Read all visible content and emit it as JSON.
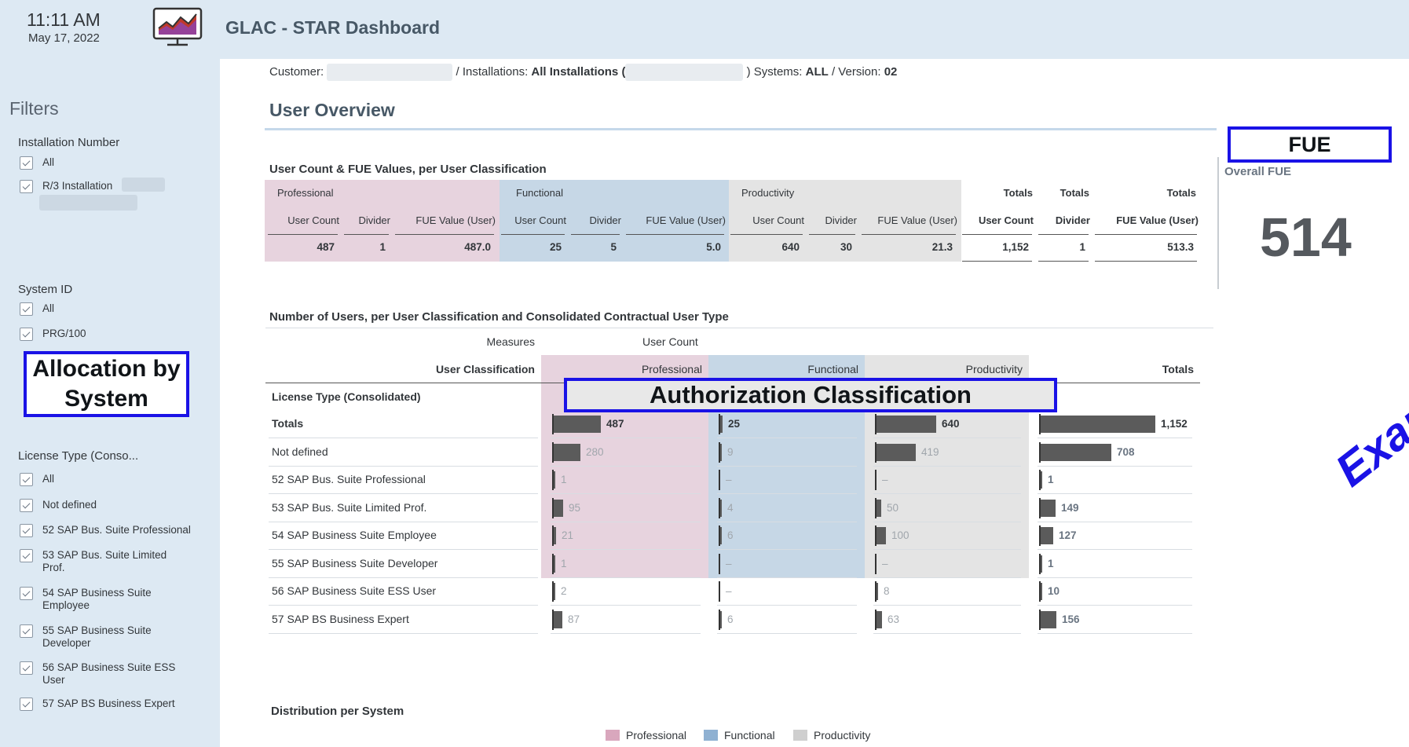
{
  "header": {
    "time": "11:11 AM",
    "date": "May 17, 2022",
    "title": "GLAC - STAR Dashboard",
    "logo_icon": "monitor-chart-icon"
  },
  "sidebar": {
    "title": "Filters",
    "groups": [
      {
        "title": "Installation Number",
        "items": [
          "All",
          "R/3 Installation"
        ]
      },
      {
        "title": "System ID",
        "items": [
          "All",
          "PRG/100"
        ]
      },
      {
        "title": "License Type (Conso...",
        "items": [
          "All",
          "Not defined",
          "52 SAP Bus. Suite Professional",
          "53 SAP Bus. Suite Limited Prof.",
          "54 SAP Business Suite Employee",
          "55 SAP Business Suite Developer",
          "56 SAP Business Suite ESS User",
          "57 SAP BS Business Expert"
        ]
      }
    ]
  },
  "breadcrumb": {
    "customer_label": "Customer:",
    "installations_label": "/ Installations:",
    "installations_value": "All Installations (",
    "systems_label": ") Systems:",
    "systems_value": "ALL",
    "version_label": "/ Version:",
    "version_value": "02"
  },
  "section_title": "User Overview",
  "fue_table": {
    "title": "User Count & FUE Values, per User Classification",
    "groups": [
      "Professional",
      "Functional",
      "Productivity",
      "Totals",
      "Totals",
      "Totals"
    ],
    "columns": [
      "User Count",
      "Divider",
      "FUE Value (User)",
      "User Count",
      "Divider",
      "FUE Value (User)",
      "User Count",
      "Divider",
      "FUE Value (User)",
      "User Count",
      "Divider",
      "FUE Value (User)"
    ],
    "values": [
      "487",
      "1",
      "487.0",
      "25",
      "5",
      "5.0",
      "640",
      "30",
      "21.3",
      "1,152",
      "1",
      "513.3"
    ]
  },
  "overall_fue": {
    "label": "Overall FUE",
    "value": "514"
  },
  "users_table": {
    "title": "Number of Users, per User Classification and Consolidated Contractual User Type",
    "measures_label": "Measures",
    "measures_value": "User Count",
    "classification_label": "User Classification",
    "license_label": "License Type (Consolidated)",
    "columns": [
      "Professional",
      "Functional",
      "Productivity",
      "Totals"
    ],
    "rows": [
      {
        "label": "Totals",
        "values": [
          487,
          25,
          640,
          1152
        ],
        "display": [
          "487",
          "25",
          "640",
          "1,152"
        ]
      },
      {
        "label": "Not defined",
        "values": [
          280,
          9,
          419,
          708
        ],
        "display": [
          "280",
          "9",
          "419",
          "708"
        ]
      },
      {
        "label": "52 SAP Bus. Suite Professional",
        "values": [
          1,
          0,
          0,
          1
        ],
        "display": [
          "1",
          "–",
          "–",
          "1"
        ]
      },
      {
        "label": "53 SAP Bus. Suite Limited Prof.",
        "values": [
          95,
          4,
          50,
          149
        ],
        "display": [
          "95",
          "4",
          "50",
          "149"
        ]
      },
      {
        "label": "54 SAP Business Suite Employee",
        "values": [
          21,
          6,
          100,
          127
        ],
        "display": [
          "21",
          "6",
          "100",
          "127"
        ]
      },
      {
        "label": "55 SAP Business Suite Developer",
        "values": [
          1,
          0,
          0,
          1
        ],
        "display": [
          "1",
          "–",
          "–",
          "1"
        ]
      },
      {
        "label": "56 SAP Business Suite ESS User",
        "values": [
          2,
          0,
          8,
          10
        ],
        "display": [
          "2",
          "–",
          "8",
          "10"
        ]
      },
      {
        "label": "57 SAP BS Business Expert",
        "values": [
          87,
          6,
          63,
          156
        ],
        "display": [
          "87",
          "6",
          "63",
          "156"
        ]
      }
    ]
  },
  "distribution": {
    "title": "Distribution per System",
    "legend": [
      {
        "name": "Professional",
        "color": "#d9a7bd"
      },
      {
        "name": "Functional",
        "color": "#8fb1d2"
      },
      {
        "name": "Productivity",
        "color": "#cfcfcf"
      }
    ]
  },
  "annotations": {
    "allocation": "Allocation by System",
    "authorization": "Authorization Classification",
    "fue": "FUE",
    "exam": "Exam"
  },
  "colors": {
    "professional_bg": "#e7d3de",
    "functional_bg": "#c6d7e6",
    "productivity_bg": "#e4e4e4",
    "annotation_blue": "#1a12e6"
  }
}
